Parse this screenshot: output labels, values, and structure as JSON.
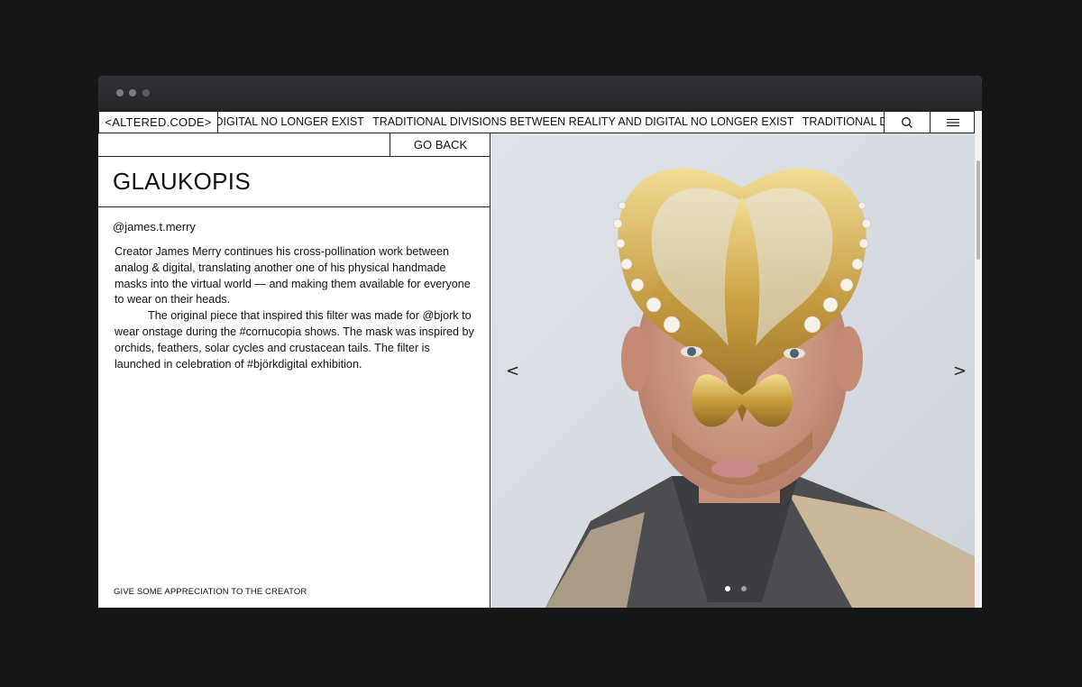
{
  "header": {
    "logo": "<ALTERED.CODE>",
    "ticker": [
      "D DIGITAL NO LONGER EXIST",
      "TRADITIONAL DIVISIONS BETWEEN REALITY AND DIGITAL NO LONGER EXIST",
      "TRADITIONAL DIVISIONS BE"
    ],
    "search_icon": "search-icon",
    "menu_icon": "hamburger-menu-icon"
  },
  "nav": {
    "go_back": "GO BACK"
  },
  "filter": {
    "title": "GLAUKOPIS",
    "handle": "@james.t.merry",
    "paragraph_1": "Creator James Merry continues his cross-pollination work between analog & digital, translating another one of his physical handmade masks into the virtual world — and making them available for everyone to wear on their heads.",
    "paragraph_2": "The original piece that inspired this filter was made for @bjork to wear onstage during the #cornucopia shows. The mask was inspired by orchids, feathers, solar cycles and crustacean tails. The filter is launched in celebration of #björkdigital exhibition.",
    "appreciation": "GIVE SOME APPRECIATION TO THE CREATOR"
  },
  "carousel": {
    "prev": "<",
    "next": ">",
    "active_slide": 1,
    "slide_count": 2
  }
}
